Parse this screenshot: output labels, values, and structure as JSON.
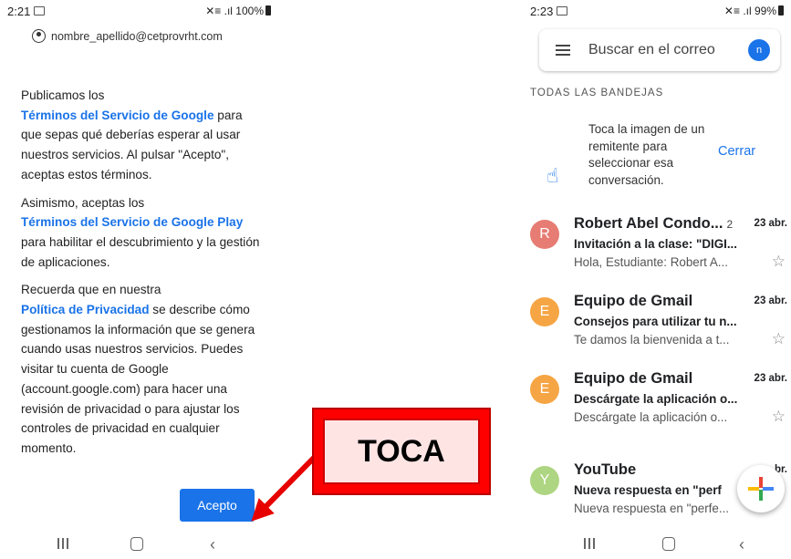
{
  "left_phone": {
    "status": {
      "time": "2:21",
      "signal": "✕≡ .ıl 100%"
    },
    "account_email": "nombre_apellido@cetprovrht.com",
    "paragraphs": [
      {
        "before": "Publicamos los",
        "link": "Términos del Servicio de Google",
        "after": " para que sepas qué deberías esperar al usar nuestros servicios. Al pulsar \"Acepto\", aceptas estos términos."
      },
      {
        "before": "Asimismo, aceptas los",
        "link": "Términos del Servicio de Google Play",
        "after": " para habilitar el descubrimiento y la gestión de aplicaciones."
      },
      {
        "before": "Recuerda que en nuestra",
        "link": "Política de Privacidad",
        "after": " se describe cómo gestionamos la información que se genera cuando usas nuestros servicios. Puedes visitar tu cuenta de Google (account.google.com) para hacer una revisión de privacidad o para ajustar los controles de privacidad en cualquier momento."
      }
    ],
    "accept_button": "Acepto"
  },
  "callout": {
    "text": "TOCA",
    "color": "#ff0000"
  },
  "right_phone": {
    "status": {
      "time": "2:23",
      "signal": "✕≡ .ıl 99%"
    },
    "search_placeholder": "Buscar en el correo",
    "avatar_letter": "n",
    "section_title": "TODAS LAS BANDEJAS",
    "tip": {
      "text": "Toca la imagen de un remitente para seleccionar esa conversación.",
      "dismiss": "Cerrar"
    },
    "emails": [
      {
        "initial": "R",
        "color": "#e67c73",
        "sender": "Robert Abel Condo...",
        "count": "2",
        "date": "23 abr.",
        "subject": "Invitación a la clase: \"DIGI...",
        "preview": "Hola, Estudiante: Robert A..."
      },
      {
        "initial": "E",
        "color": "#f6a544",
        "sender": "Equipo de Gmail",
        "count": "",
        "date": "23 abr.",
        "subject": "Consejos para utilizar tu n...",
        "preview": "Te damos la bienvenida a t..."
      },
      {
        "initial": "E",
        "color": "#f6a544",
        "sender": "Equipo de Gmail",
        "count": "",
        "date": "23 abr.",
        "subject": "Descárgate la aplicación o...",
        "preview": "Descárgate la aplicación o..."
      },
      {
        "initial": "Y",
        "color": "#aed581",
        "sender": "YouTube",
        "count": "",
        "date": "br.",
        "subject": "Nueva respuesta en \"perf",
        "preview": "Nueva respuesta en \"perfe..."
      }
    ]
  }
}
